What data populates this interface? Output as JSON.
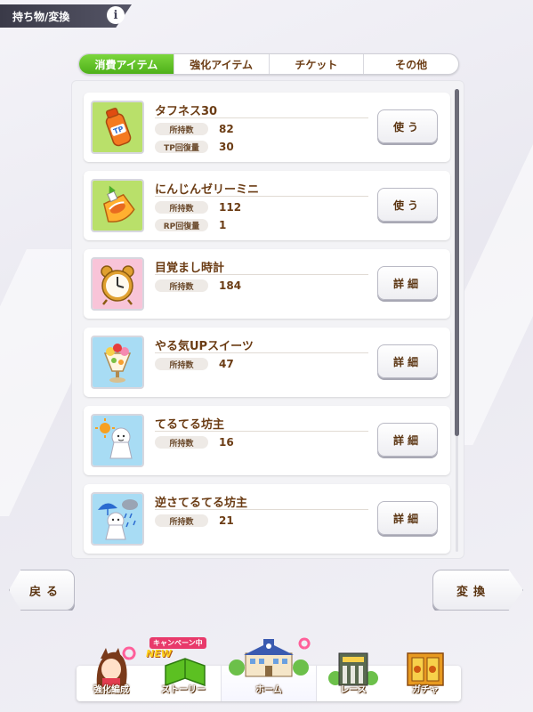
{
  "header": {
    "title": "持ち物/変換",
    "info_icon": "info-icon"
  },
  "tabs": [
    {
      "label": "消費アイテム",
      "active": true
    },
    {
      "label": "強化アイテム",
      "active": false
    },
    {
      "label": "チケット",
      "active": false
    },
    {
      "label": "その他",
      "active": false
    }
  ],
  "items": [
    {
      "name": "タフネス30",
      "icon": "tp-drink-bottle-icon",
      "stats": [
        {
          "label": "所持数",
          "value": "82"
        },
        {
          "label": "TP回復量",
          "value": "30"
        }
      ],
      "action": "使う"
    },
    {
      "name": "にんじんゼリーミニ",
      "icon": "carrot-jelly-icon",
      "stats": [
        {
          "label": "所持数",
          "value": "112"
        },
        {
          "label": "RP回復量",
          "value": "1"
        }
      ],
      "action": "使う"
    },
    {
      "name": "目覚まし時計",
      "icon": "alarm-clock-icon",
      "stats": [
        {
          "label": "所持数",
          "value": "184"
        }
      ],
      "action": "詳細"
    },
    {
      "name": "やる気UPスイーツ",
      "icon": "parfait-icon",
      "stats": [
        {
          "label": "所持数",
          "value": "47"
        }
      ],
      "action": "詳細"
    },
    {
      "name": "てるてる坊主",
      "icon": "teru-teru-bozu-sun-icon",
      "stats": [
        {
          "label": "所持数",
          "value": "16"
        }
      ],
      "action": "詳細"
    },
    {
      "name": "逆さてるてる坊主",
      "icon": "teru-teru-bozu-rain-icon",
      "stats": [
        {
          "label": "所持数",
          "value": "21"
        }
      ],
      "action": "詳細"
    }
  ],
  "buttons": {
    "back": "戻る",
    "convert": "変換"
  },
  "nav": {
    "items": [
      {
        "label": "強化編成"
      },
      {
        "label": "ストーリー"
      },
      {
        "label": "ホーム"
      },
      {
        "label": "レース"
      },
      {
        "label": "ガチャ"
      }
    ],
    "campaign_badge": "キャンペーン中",
    "new_badge": "NEW"
  },
  "colors": {
    "accent_green": "#5cc022",
    "text_brown": "#6b3c14",
    "header_dark": "#3a3a48"
  }
}
